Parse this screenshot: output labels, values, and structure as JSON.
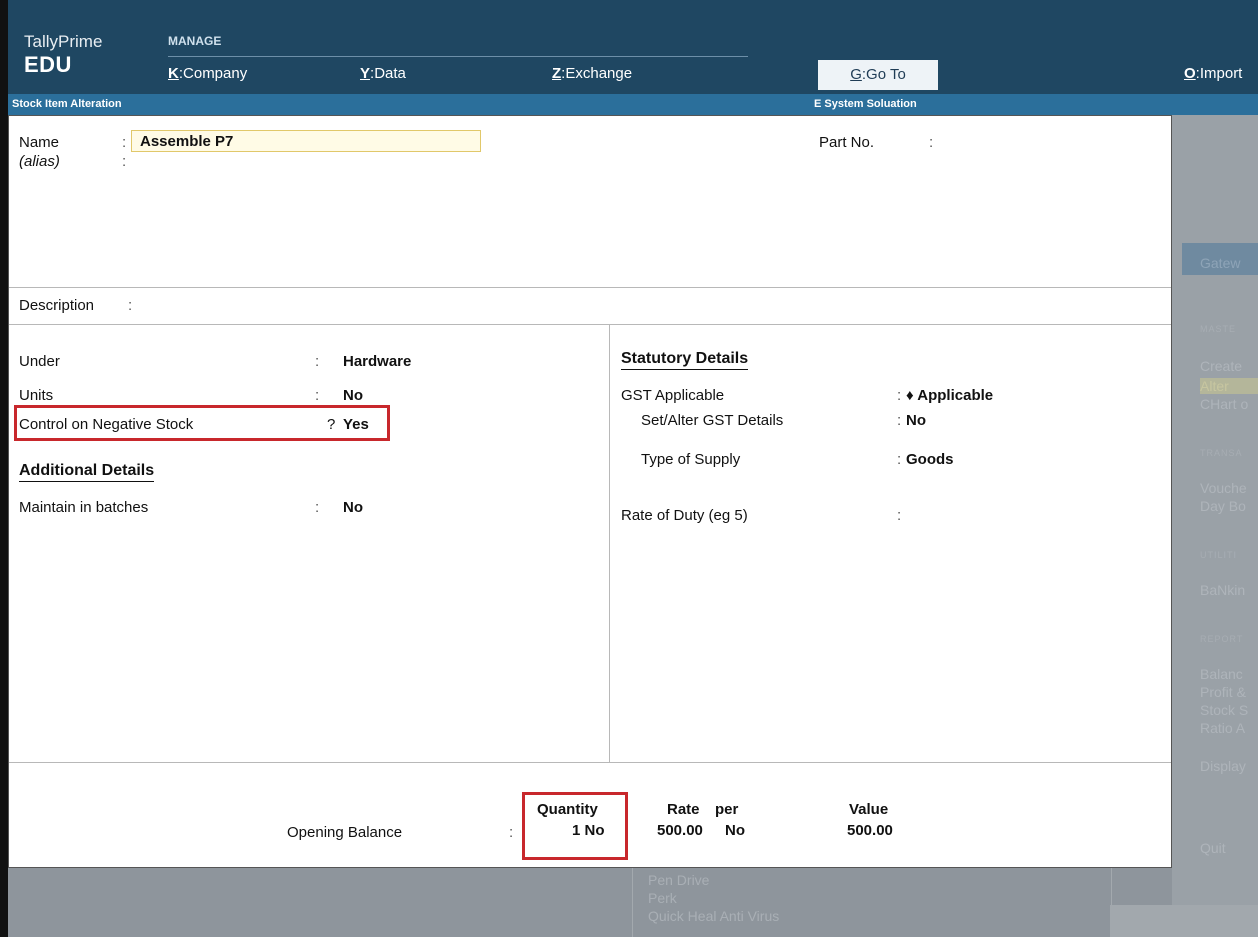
{
  "app": {
    "product": "TallyPrime",
    "edition": "EDU"
  },
  "topmenu": {
    "section_label": "MANAGE",
    "items": [
      {
        "key": "K",
        "label": "Company"
      },
      {
        "key": "Y",
        "label": "Data"
      },
      {
        "key": "Z",
        "label": "Exchange"
      }
    ],
    "goto": {
      "key": "G",
      "label": "Go To"
    },
    "import": {
      "key": "O",
      "label": "Import"
    }
  },
  "subbar": {
    "screen_title": "Stock Item Alteration",
    "company": "E System Soluation"
  },
  "form": {
    "name_label": "Name",
    "name_value": "Assemble P7",
    "alias_label": "(alias)",
    "part_no_label": "Part No.",
    "description_label": "Description",
    "under_label": "Under",
    "under_value": "Hardware",
    "units_label": "Units",
    "units_value": "No",
    "neg_stock_label": "Control on Negative Stock",
    "neg_stock_prompt": "?",
    "neg_stock_value": "Yes",
    "additional_header": "Additional Details",
    "batches_label": "Maintain in batches",
    "batches_value": "No",
    "statutory_header": "Statutory Details",
    "gst_label": "GST Applicable",
    "gst_value": "♦ Applicable",
    "gst_details_label": "Set/Alter GST Details",
    "gst_details_value": "No",
    "supply_label": "Type of Supply",
    "supply_value": "Goods",
    "duty_label": "Rate of Duty (eg 5)"
  },
  "opening": {
    "label": "Opening Balance",
    "quantity_header": "Quantity",
    "rate_header": "Rate",
    "per_header": "per",
    "value_header": "Value",
    "quantity": "1 No",
    "rate": "500.00",
    "per": "No",
    "value": "500.00"
  },
  "background_panel": {
    "items": [
      "Gatew",
      "MASTE",
      "Create",
      "Alter",
      "CHart o",
      "TRANSA",
      "Vouche",
      "Day Bo",
      "UTILITI",
      "BaNkin",
      "REPORT",
      "Balanc",
      "Profit &",
      "Stock S",
      "Ratio A",
      "Display",
      "Quit"
    ]
  },
  "background_list": {
    "items": [
      "Pen Drive",
      "Perk",
      "Quick Heal Anti Virus"
    ]
  }
}
